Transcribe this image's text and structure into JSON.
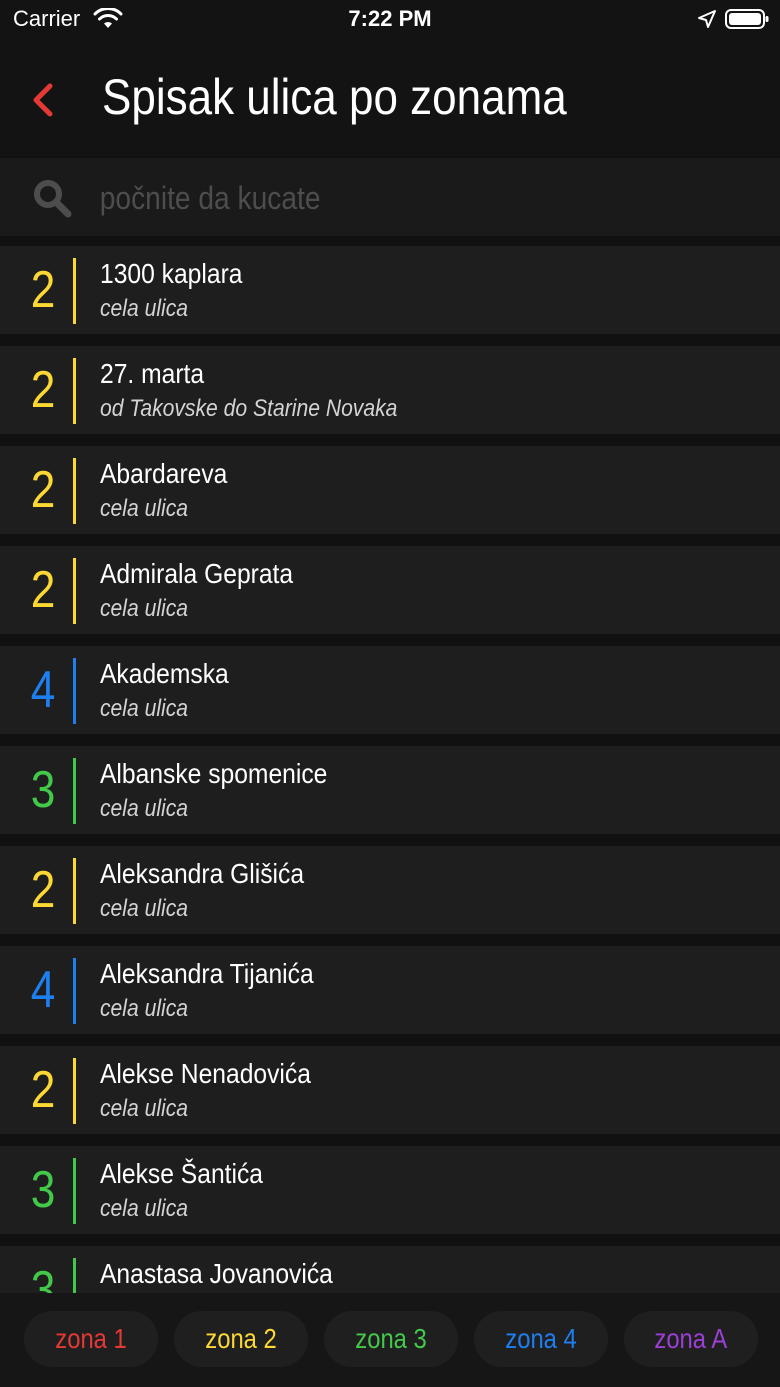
{
  "status_bar": {
    "carrier": "Carrier",
    "time": "7:22 PM"
  },
  "nav": {
    "title": "Spisak ulica po zonama",
    "back_icon": "chevron-left-icon"
  },
  "search": {
    "placeholder": "počnite da kucate",
    "value": ""
  },
  "colors": {
    "zone1": "#e53935",
    "zone2": "#fdd835",
    "zone3": "#43c94a",
    "zone4": "#1e7ff0",
    "zoneA": "#9c3fd6",
    "back": "#e53935"
  },
  "streets": [
    {
      "zone": "2",
      "name": "1300 kaplara",
      "desc": "cela ulica"
    },
    {
      "zone": "2",
      "name": "27. marta",
      "desc": "od Takovske do Starine Novaka"
    },
    {
      "zone": "2",
      "name": "Abardareva",
      "desc": "cela ulica"
    },
    {
      "zone": "2",
      "name": "Admirala Geprata",
      "desc": "cela ulica"
    },
    {
      "zone": "4",
      "name": "Akademska",
      "desc": "cela ulica"
    },
    {
      "zone": "3",
      "name": "Albanske spomenice",
      "desc": "cela ulica"
    },
    {
      "zone": "2",
      "name": "Aleksandra Glišića",
      "desc": "cela ulica"
    },
    {
      "zone": "4",
      "name": "Aleksandra Tijanića",
      "desc": "cela ulica"
    },
    {
      "zone": "2",
      "name": "Alekse Nenadovića",
      "desc": "cela ulica"
    },
    {
      "zone": "3",
      "name": "Alekse Šantića",
      "desc": "cela ulica"
    },
    {
      "zone": "3",
      "name": "Anastasa Jovanovića",
      "desc": ""
    }
  ],
  "tabs": [
    {
      "label": "zona 1",
      "color": "#e53935"
    },
    {
      "label": "zona 2",
      "color": "#fdd835"
    },
    {
      "label": "zona 3",
      "color": "#43c94a"
    },
    {
      "label": "zona 4",
      "color": "#1e7ff0"
    },
    {
      "label": "zona A",
      "color": "#9c3fd6"
    }
  ]
}
